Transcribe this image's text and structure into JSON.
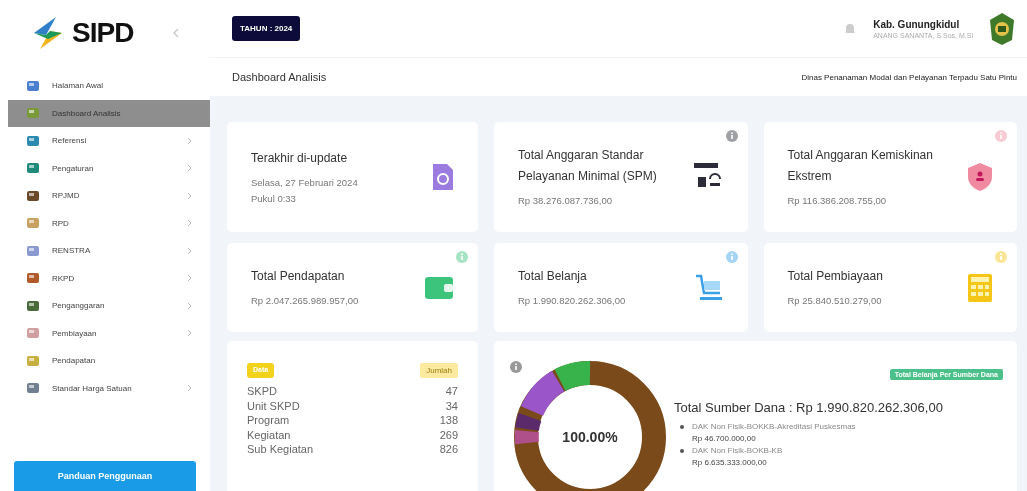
{
  "sidebar": {
    "logo": "SIPD",
    "items": [
      {
        "label": "Halaman Awal",
        "selected": false,
        "has_submenu": false
      },
      {
        "label": "Dashboard Analisis",
        "selected": true,
        "has_submenu": false
      },
      {
        "label": "Referensi",
        "selected": false,
        "has_submenu": true
      },
      {
        "label": "Pengaturan",
        "selected": false,
        "has_submenu": true
      },
      {
        "label": "RPJMD",
        "selected": false,
        "has_submenu": true
      },
      {
        "label": "RPD",
        "selected": false,
        "has_submenu": true
      },
      {
        "label": "RENSTRA",
        "selected": false,
        "has_submenu": true
      },
      {
        "label": "RKPD",
        "selected": false,
        "has_submenu": true
      },
      {
        "label": "Penganggaran",
        "selected": false,
        "has_submenu": true
      },
      {
        "label": "Pembiayaan",
        "selected": false,
        "has_submenu": true
      },
      {
        "label": "Pendapatan",
        "selected": false,
        "has_submenu": false
      },
      {
        "label": "Standar Harga Satuan",
        "selected": false,
        "has_submenu": true
      }
    ],
    "button": "Panduan Penggunaan"
  },
  "header": {
    "year": "TAHUN : 2024",
    "user_name": "Kab. Gunungkidul",
    "user_role": "ANANG SANANTA, S.Sos, M.Si"
  },
  "page": {
    "title": "Dashboard Analisis",
    "unit": "Dinas Penanaman Modal dan Pelayanan Terpadu Satu Pintu"
  },
  "cards": [
    {
      "kind": "update",
      "title": "Terakhir di-update",
      "lines": [
        "Selasa, 27 Februari 2024",
        "Pukul 0:33"
      ],
      "color": "#9b7be0",
      "info": false
    },
    {
      "kind": "spm",
      "title": "Total Anggaran Standar Pelayanan Minimal (SPM)",
      "lines": [
        "Rp 38.276.087.736,00"
      ],
      "color": "#2b2b3a",
      "info": true
    },
    {
      "kind": "poverty",
      "title": "Total Anggaran Kemiskinan Ekstrem",
      "lines": [
        "Rp 116.386.208.755,00"
      ],
      "color": "#f08aa0",
      "info": true
    },
    {
      "kind": "wallet",
      "title": "Total Pendapatan",
      "lines": [
        "Rp 2.047.265.989.957,00"
      ],
      "color": "#3cc47c",
      "info": true
    },
    {
      "kind": "cart",
      "title": "Total Belanja",
      "lines": [
        "Rp 1.990.820.262.306,00"
      ],
      "color": "#3aa0e8",
      "info": true
    },
    {
      "kind": "calculator",
      "title": "Total Pembiayaan",
      "lines": [
        "Rp 25.840.510.279,00"
      ],
      "color": "#f5c518",
      "info": true
    }
  ],
  "counts": {
    "badge": "Data",
    "badge_2": "Jumlah",
    "rows": [
      {
        "label": "SKPD",
        "value": "47"
      },
      {
        "label": "Unit SKPD",
        "value": "34"
      },
      {
        "label": "Program",
        "value": "138"
      },
      {
        "label": "Kegiatan",
        "value": "269"
      },
      {
        "label": "Sub Kegiatan",
        "value": "826"
      }
    ]
  },
  "sources": {
    "center": "100.00%",
    "badge": "Total Belanja Per Sumber Dana",
    "total": "Total Sumber Dana : Rp 1.990.820.262.306,00",
    "items": [
      {
        "name": "DAK Non Fisik-BOKKB-Akreditasi Puskesmas",
        "amount": "Rp 46.700.000,00"
      },
      {
        "name": "DAK Non Fisik-BOKB-KB",
        "amount": "Rp 6.635.333.000,00"
      }
    ]
  }
}
